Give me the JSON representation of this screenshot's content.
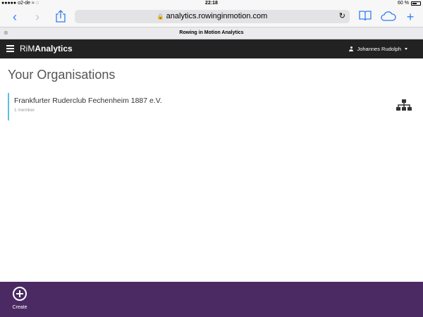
{
  "status_bar": {
    "carrier": "●●●●● o2-de",
    "time": "22:18",
    "battery": "60 %"
  },
  "browser": {
    "url": "analytics.rowinginmotion.com",
    "tab_title": "Rowing in Motion Analytics",
    "icons": [
      "back-icon",
      "forward-icon",
      "share-icon",
      "lock-icon",
      "reload-icon",
      "bookmarks-icon",
      "cloud-tabs-icon",
      "new-tab-icon",
      "close-tab-icon"
    ]
  },
  "app": {
    "brand_prefix": "RiM",
    "brand_suffix": "Analytics",
    "user_name": "Johannes Rudolph"
  },
  "main": {
    "title": "Your Organisations",
    "organisations": [
      {
        "name": "Frankfurter Ruderclub Fechenheim 1887 e.V.",
        "members": "1 member",
        "icon": "org-hierarchy-icon"
      }
    ]
  },
  "bottom": {
    "create_label": "Create",
    "color": "#4b2a64"
  },
  "colors": {
    "accent": "#5bc0de",
    "navbar": "#222222",
    "link": "#2f7cf6"
  }
}
